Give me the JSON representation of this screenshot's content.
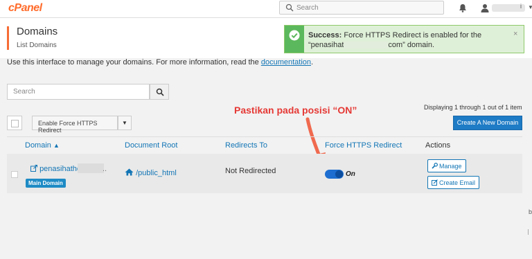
{
  "topbar": {
    "logo": "cPanel",
    "search_placeholder": "Search",
    "user_initial": "i"
  },
  "header": {
    "title": "Domains",
    "subtitle": "List Domains"
  },
  "alert": {
    "strong": "Success:",
    "message": "Force HTTPS Redirect is enabled for the",
    "domain_prefix": "“penasihat",
    "domain_suffix": "com” domain.",
    "close": "×"
  },
  "intro": {
    "text": "Use this interface to manage your domains. For more information, read the ",
    "link": "documentation",
    "end": "."
  },
  "search": {
    "placeholder": "Search"
  },
  "annotation": "Pastikan pada posisi “ON”",
  "pagination": "Displaying 1 through 1 out of 1 item",
  "toolbar": {
    "bulk_action": "Enable Force HTTPS Redirect",
    "create_button": "Create A New Domain"
  },
  "table": {
    "headers": [
      "Domain",
      "Document Root",
      "Redirects To",
      "Force HTTPS Redirect",
      "Actions"
    ],
    "rows": [
      {
        "domain": "penasihatho",
        "domain_trailing": "..",
        "badge": "Main Domain",
        "document_root": "/public_html",
        "redirects_to": "Not Redirected",
        "force_https_state": "On",
        "actions": [
          "Manage",
          "Create Email"
        ]
      }
    ]
  },
  "edge": {
    "letter": "b"
  },
  "colors": {
    "brand": "#ff6c2c",
    "link": "#1275b5",
    "primary_button": "#1e7bc5",
    "success_bg": "#dff0d8",
    "success_icon": "#5cb85c",
    "annotation": "#e53935",
    "toggle_on": "#1d6ed0"
  },
  "icons": [
    "search-icon",
    "bell-icon",
    "user-icon",
    "check-circle-icon",
    "close-icon",
    "sort-up-icon",
    "external-link-icon",
    "home-icon",
    "wrench-icon",
    "edit-icon",
    "arrow-annotation"
  ]
}
